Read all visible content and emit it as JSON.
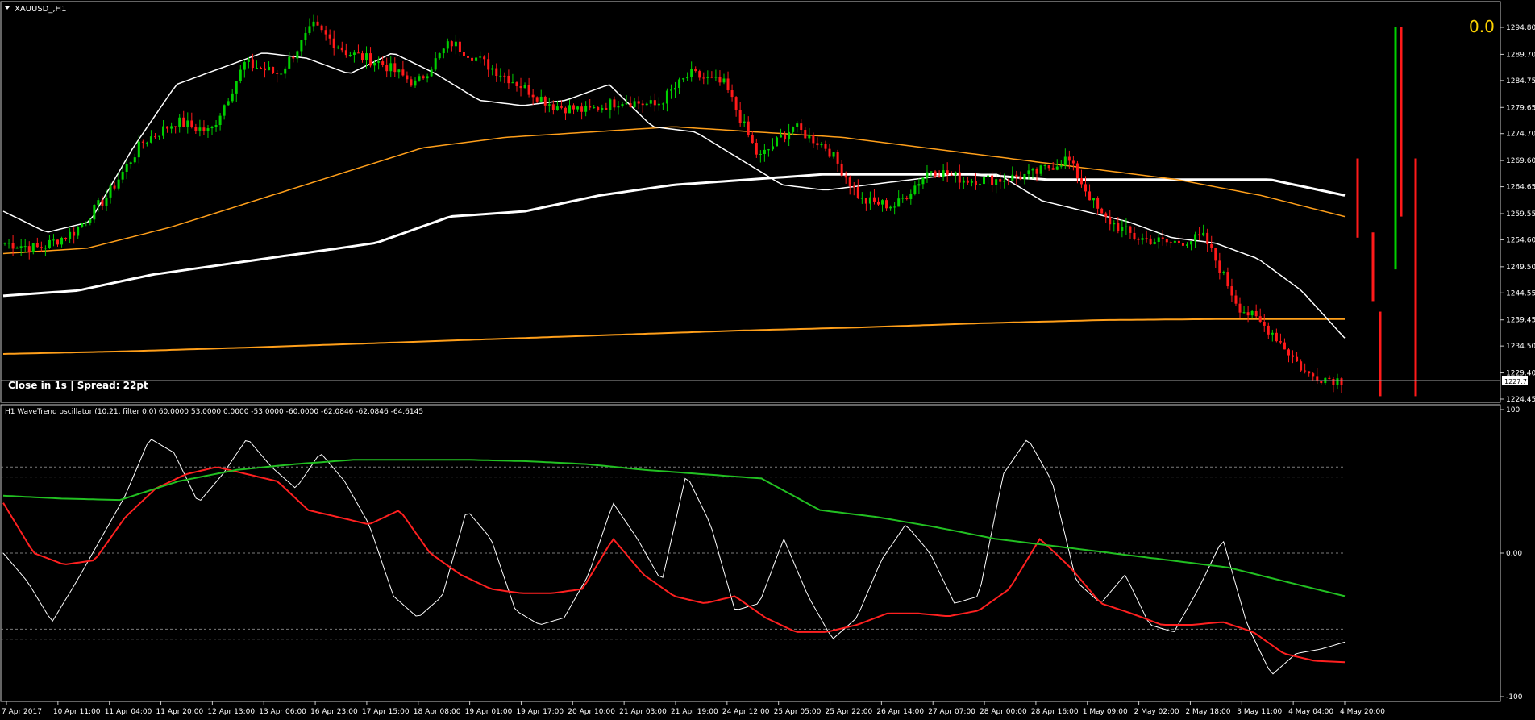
{
  "chart_data": [
    {
      "type": "candlestick",
      "title": "XAUUSD_,H1",
      "info": "Close in 1s | Spread: 22pt",
      "corner_value": "0.0",
      "ylim": [
        1224.45,
        1294.8
      ],
      "y_ticks": [
        "1294.80",
        "1289.70",
        "1284.75",
        "1279.65",
        "1274.70",
        "1269.60",
        "1264.65",
        "1259.55",
        "1254.60",
        "1249.50",
        "1244.55",
        "1239.45",
        "1234.50",
        "1229.40",
        "1224.45"
      ],
      "current_price": "1227.71",
      "x_ticks": [
        "7 Apr 2017",
        "10 Apr 11:00",
        "11 Apr 04:00",
        "11 Apr 20:00",
        "12 Apr 13:00",
        "13 Apr 06:00",
        "16 Apr 23:00",
        "17 Apr 15:00",
        "18 Apr 08:00",
        "19 Apr 01:00",
        "19 Apr 17:00",
        "20 Apr 10:00",
        "21 Apr 03:00",
        "21 Apr 19:00",
        "24 Apr 12:00",
        "25 Apr 05:00",
        "25 Apr 22:00",
        "26 Apr 14:00",
        "27 Apr 07:00",
        "28 Apr 00:00",
        "28 Apr 16:00",
        "1 May 09:00",
        "2 May 02:00",
        "2 May 18:00",
        "3 May 11:00",
        "4 May 04:00",
        "4 May 20:00"
      ],
      "close_anchors": [
        1254,
        1253,
        1256,
        1263,
        1273,
        1277,
        1275,
        1288,
        1286,
        1295,
        1290,
        1288,
        1284,
        1292,
        1288,
        1284,
        1280,
        1279,
        1281,
        1280,
        1286,
        1284,
        1270,
        1276,
        1272,
        1262,
        1261,
        1268,
        1266,
        1266,
        1267,
        1270,
        1259,
        1255,
        1254,
        1255,
        1242,
        1237,
        1229,
        1228
      ],
      "ma_fast_anchors": [
        1260,
        1256,
        1258,
        1272,
        1284,
        1287,
        1290,
        1289,
        1286,
        1290,
        1286,
        1281,
        1280,
        1281,
        1284,
        1276,
        1275,
        1270,
        1265,
        1264,
        1265,
        1266,
        1267,
        1267,
        1262,
        1260,
        1258,
        1255,
        1254,
        1251,
        1245,
        1236
      ],
      "ma_slow_white_anchors": [
        1244,
        1245,
        1248,
        1250,
        1252,
        1254,
        1259,
        1260,
        1263,
        1265,
        1266,
        1267,
        1267,
        1267,
        1266,
        1266,
        1266,
        1266,
        1263
      ],
      "ma_slow_orange_anchors": [
        1252,
        1253,
        1257,
        1262,
        1267,
        1272,
        1274,
        1275,
        1276,
        1275,
        1274,
        1272,
        1270,
        1268,
        1266,
        1263,
        1259
      ],
      "ma_long_orange_anchors": [
        1233,
        1233.5,
        1234.2,
        1235,
        1235.8,
        1236.6,
        1237.4,
        1238,
        1238.8,
        1239.4,
        1239.6,
        1239.6
      ],
      "future_bars": [
        {
          "dir": "down",
          "high": 1270,
          "low": 1255
        },
        {
          "dir": "down",
          "high": 1256,
          "low": 1243
        },
        {
          "dir": "down",
          "high": 1241,
          "low": 1225
        },
        {
          "dir": "up",
          "high": 1294.8,
          "low": 1249
        },
        {
          "dir": "down",
          "high": 1294.8,
          "low": 1259
        },
        {
          "dir": "down",
          "high": 1270,
          "low": 1225
        }
      ]
    },
    {
      "type": "line",
      "title": "H1 WaveTrend oscillator (10,21, filter 0.0) 60.0000 53.0000 0.0000 -53.0000 -60.0000 -62.0846 -62.0846 -64.6145",
      "ylim": [
        -100,
        100
      ],
      "y_ticks": [
        "100",
        "0.00",
        "-100"
      ],
      "levels": [
        60,
        53,
        0,
        -53,
        -60
      ],
      "series": [
        {
          "color": "#ffffff",
          "values": [
            0,
            -20,
            -48,
            -20,
            10,
            40,
            80,
            70,
            35,
            55,
            80,
            60,
            45,
            70,
            50,
            20,
            -30,
            -45,
            -30,
            30,
            10,
            -40,
            -50,
            -45,
            -15,
            35,
            10,
            -20,
            55,
            20,
            -40,
            -35,
            10,
            -30,
            -60,
            -45,
            -5,
            20,
            0,
            -35,
            -30,
            55,
            80,
            50,
            -20,
            -35,
            -15,
            -50,
            -55,
            -25,
            10,
            -50,
            -85,
            -70,
            -67,
            -62
          ]
        },
        {
          "color": "#ff2020",
          "values": [
            35,
            0,
            -8,
            -5,
            25,
            45,
            55,
            60,
            55,
            50,
            30,
            25,
            20,
            30,
            0,
            -15,
            -25,
            -28,
            -28,
            -25,
            10,
            -15,
            -30,
            -35,
            -30,
            -45,
            -55,
            -55,
            -50,
            -42,
            -42,
            -44,
            -40,
            -25,
            10,
            -10,
            -35,
            -42,
            -50,
            -50,
            -48,
            -55,
            -70,
            -75,
            -76
          ]
        },
        {
          "color": "#22c022",
          "values": [
            40,
            38,
            37,
            50,
            58,
            62,
            65,
            65,
            65,
            64,
            62,
            58,
            55,
            52,
            30,
            25,
            18,
            10,
            5,
            0,
            -5,
            -10,
            -20,
            -30
          ]
        }
      ],
      "current_values": [
        "-62.0846",
        "-64.6145"
      ]
    }
  ]
}
